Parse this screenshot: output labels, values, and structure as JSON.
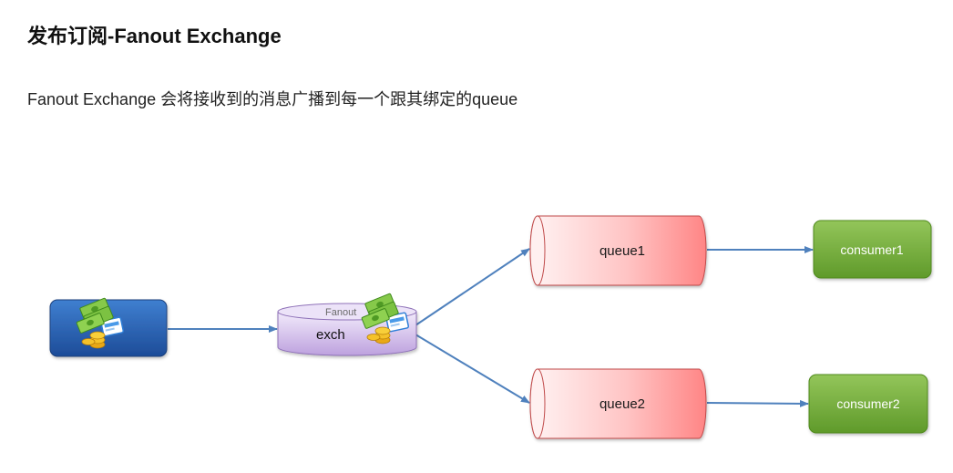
{
  "title": "发布订阅-Fanout Exchange",
  "description": "Fanout Exchange 会将接收到的消息广播到每一个跟其绑定的queue",
  "diagram": {
    "publisher": {
      "icon": "money-icon"
    },
    "exchange": {
      "type_label": "Fanout",
      "name_label": "exch",
      "icon": "money-icon"
    },
    "queues": [
      {
        "label": "queue1"
      },
      {
        "label": "queue2"
      }
    ],
    "consumers": [
      {
        "label": "consumer1"
      },
      {
        "label": "consumer2"
      }
    ]
  },
  "colors": {
    "arrow": "#4f81bd",
    "publisher": "#2a62b5",
    "exchange": "#c9b3e6",
    "queue": "#ff8f8f",
    "consumer": "#7cb342"
  }
}
